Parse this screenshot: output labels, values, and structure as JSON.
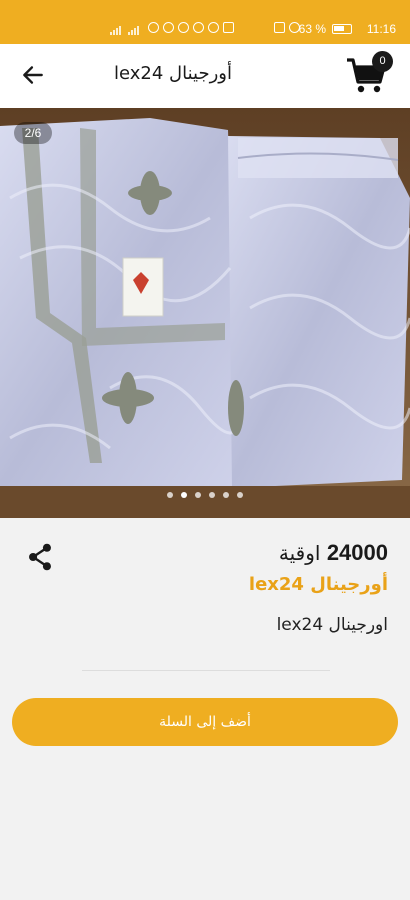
{
  "status_bar": {
    "time": "11:16",
    "battery": "63 %"
  },
  "header": {
    "title": "أورجينال lex24",
    "cart_count": "0"
  },
  "gallery": {
    "counter": "2/6",
    "total_images": 6,
    "active_index": 1
  },
  "product": {
    "price_value": "24000",
    "currency": "اوقية",
    "name": "أورجينال lex24",
    "description": "اورجينال lex24"
  },
  "actions": {
    "add_to_cart": "أضف إلى السلة"
  },
  "colors": {
    "accent": "#efae21",
    "name_color": "#e9a218"
  }
}
